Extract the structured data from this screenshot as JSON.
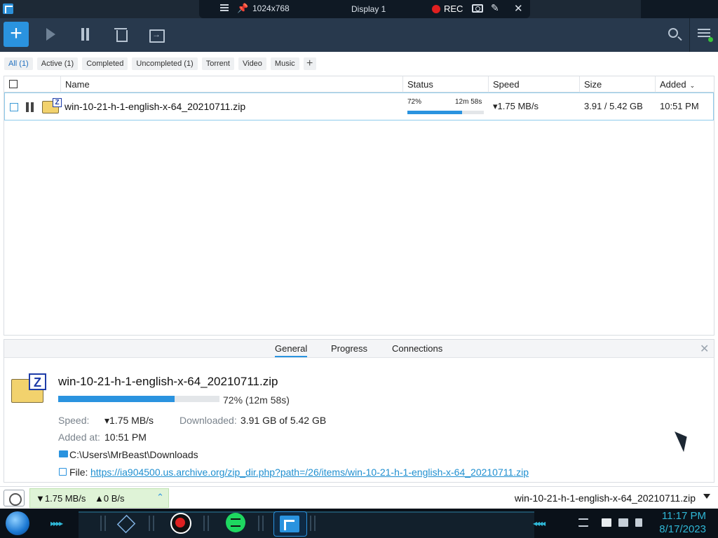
{
  "remote_bar": {
    "resolution": "1024x768",
    "display": "Display 1",
    "rec_label": "REC"
  },
  "toolbar": {
    "add_icon": "plus-icon",
    "start_icon": "play-icon",
    "pause_icon": "pause-icon",
    "delete_icon": "trash-icon",
    "move_icon": "move-folder-icon",
    "search_icon": "search-icon",
    "menu_icon": "hamburger-menu-icon",
    "accent": "#2a93df"
  },
  "categories": [
    {
      "label": "All (1)",
      "active": true
    },
    {
      "label": "Active (1)"
    },
    {
      "label": "Completed"
    },
    {
      "label": "Uncompleted (1)"
    },
    {
      "label": "Torrent"
    },
    {
      "label": "Video"
    },
    {
      "label": "Music"
    }
  ],
  "list": {
    "columns": {
      "name": "Name",
      "status": "Status",
      "speed": "Speed",
      "size": "Size",
      "added": "Added"
    },
    "rows": [
      {
        "name": "win-10-21-h-1-english-x-64_20210711.zip",
        "percent": "72%",
        "progress": 0.72,
        "eta": "12m 58s",
        "speed": "▾1.75 MB/s",
        "size": "3.91 / 5.42 GB",
        "added": "10:51 PM"
      }
    ]
  },
  "detail": {
    "tabs": [
      "General",
      "Progress",
      "Connections"
    ],
    "file_name": "win-10-21-h-1-english-x-64_20210711.zip",
    "progress": 0.72,
    "progress_text": "72% (12m 58s)",
    "speed_label": "Speed:",
    "speed_value": "▾1.75 MB/s",
    "downloaded_label": "Downloaded:",
    "downloaded_value": "3.91 GB of 5.42 GB",
    "added_label": "Added at:",
    "added_value": "10:51 PM",
    "folder": "C:\\Users\\MrBeast\\Downloads",
    "file_label": "File:",
    "file_url": "https://ia904500.us.archive.org/zip_dir.php?path=/26/items/win-10-21-h-1-english-x-64_20210711.zip"
  },
  "statusbar": {
    "down_speed": "▼1.75 MB/s",
    "up_speed": "▲0 B/s",
    "current_file": "win-10-21-h-1-english-x-64_20210711.zip"
  },
  "taskbar": {
    "time": "11:17 PM",
    "date": "8/17/2023",
    "clock_color": "#2fb7d6"
  }
}
